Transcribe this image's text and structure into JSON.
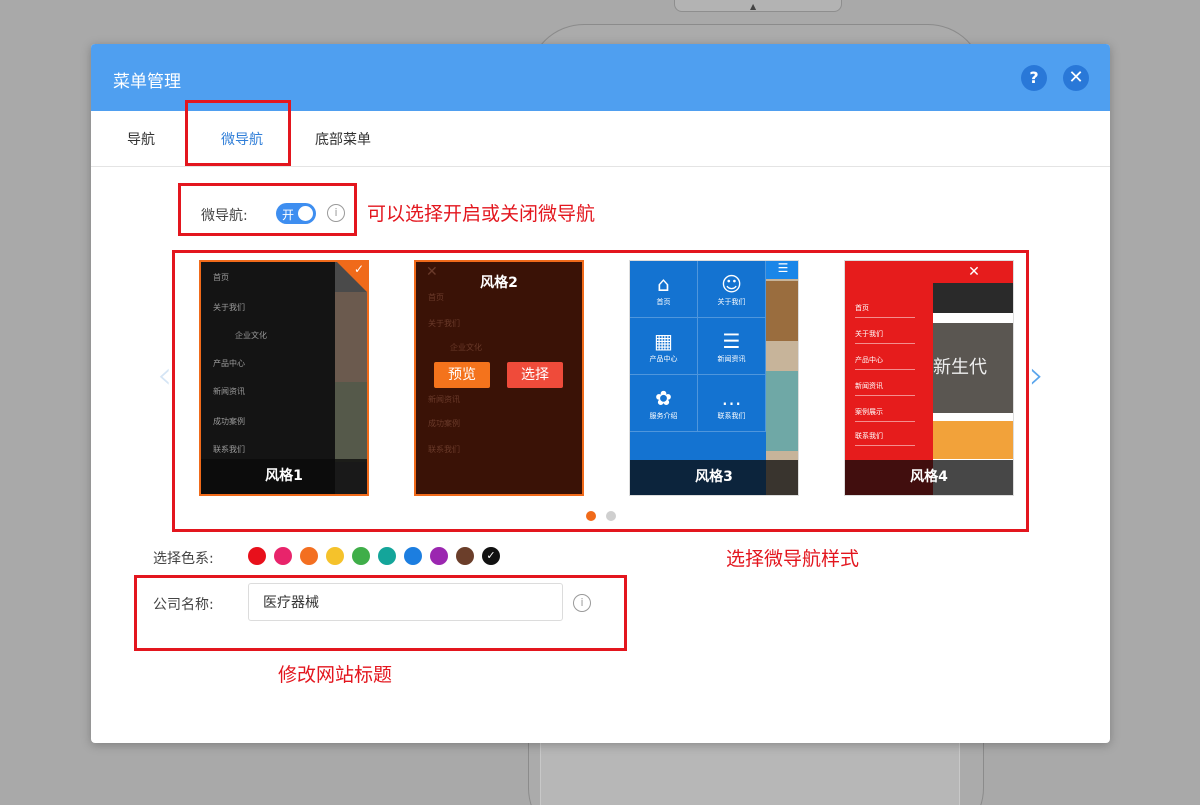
{
  "dialog": {
    "title": "菜单管理",
    "help_icon": "?",
    "close_icon": "✕"
  },
  "tabs": [
    {
      "label": "导航"
    },
    {
      "label": "微导航"
    },
    {
      "label": "底部菜单"
    }
  ],
  "micro_nav_toggle": {
    "label": "微导航:",
    "state_text": "开",
    "enabled": true
  },
  "styles": {
    "cards": [
      {
        "caption": "风格1",
        "selected": true,
        "menu_items": [
          "首页",
          "关于我们",
          "企业文化",
          "产品中心",
          "新闻资讯",
          "成功案例",
          "联系我们"
        ]
      },
      {
        "title": "风格2",
        "preview_label": "预览",
        "select_label": "选择",
        "menu_items": [
          "首页",
          "关于我们",
          "企业文化",
          "新闻资讯",
          "成功案例",
          "联系我们"
        ]
      },
      {
        "caption": "风格3",
        "grid_items": [
          {
            "icon": "home-icon",
            "glyph": "⌂",
            "label": "首页"
          },
          {
            "icon": "user-icon",
            "glyph": "☺",
            "label": "关于我们"
          },
          {
            "icon": "grid-icon",
            "glyph": "▦",
            "label": "产品中心"
          },
          {
            "icon": "list-icon",
            "glyph": "☰",
            "label": "新闻资讯"
          },
          {
            "icon": "flower-icon",
            "glyph": "✿",
            "label": "服务介绍"
          },
          {
            "icon": "chat-icon",
            "glyph": "…",
            "label": "联系我们"
          }
        ]
      },
      {
        "caption": "风格4",
        "menu_items": [
          "首页",
          "关于我们",
          "产品中心",
          "新闻资讯",
          "案例展示",
          "联系我们"
        ],
        "image_text": "新生代"
      }
    ],
    "page_count": 2,
    "current_page": 1
  },
  "color_scheme": {
    "label": "选择色系:",
    "swatches": [
      "#e8101b",
      "#e8246b",
      "#f36f21",
      "#f5c22b",
      "#3fae49",
      "#14a59a",
      "#1c7ee0",
      "#9b27b0",
      "#6b3e2a",
      "#111111"
    ],
    "selected_index": 9,
    "check_glyph": "✓"
  },
  "company_name": {
    "label": "公司名称:",
    "value": "医疗器械"
  },
  "annotations": {
    "toggle_note": "可以选择开启或关闭微导航",
    "style_note": "选择微导航样式",
    "title_note": "修改网站标题",
    "color": "#e3161e"
  }
}
